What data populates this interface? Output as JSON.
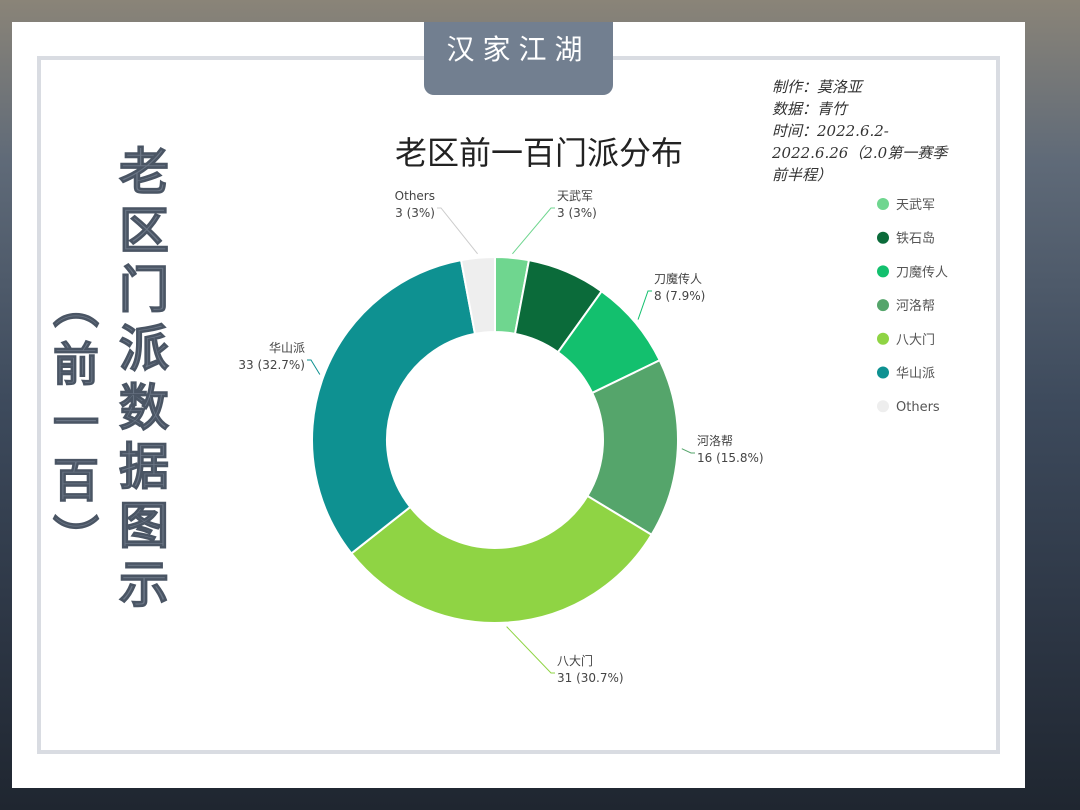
{
  "header": {
    "tab_title": "汉家江湖"
  },
  "side_title": {
    "main": "老区门派数据图示",
    "sub": "（前一百）"
  },
  "meta": {
    "lines": [
      "制作：莫洛亚",
      "数据：青竹",
      "时间：2022.6.2-",
      "2022.6.26（2.0第一赛季",
      "前半程）"
    ]
  },
  "chart_data": {
    "type": "pie",
    "style": "donut",
    "title": "老区前一百门派分布",
    "legend_position": "right",
    "categories": [
      "天武军",
      "铁石岛",
      "刀魔传人",
      "河洛帮",
      "八大门",
      "华山派",
      "Others"
    ],
    "values": [
      3,
      7,
      8,
      16,
      31,
      33,
      3
    ],
    "labels": [
      "3 (3%)",
      "",
      "8 (7.9%)",
      "16 (15.8%)",
      "31 (30.7%)",
      "33 (32.7%)",
      "3 (3%)"
    ],
    "colors": [
      "#6fd68f",
      "#0b6b3a",
      "#13c06e",
      "#55a56b",
      "#8fd444",
      "#0e9191",
      "#eeeeee"
    ]
  }
}
